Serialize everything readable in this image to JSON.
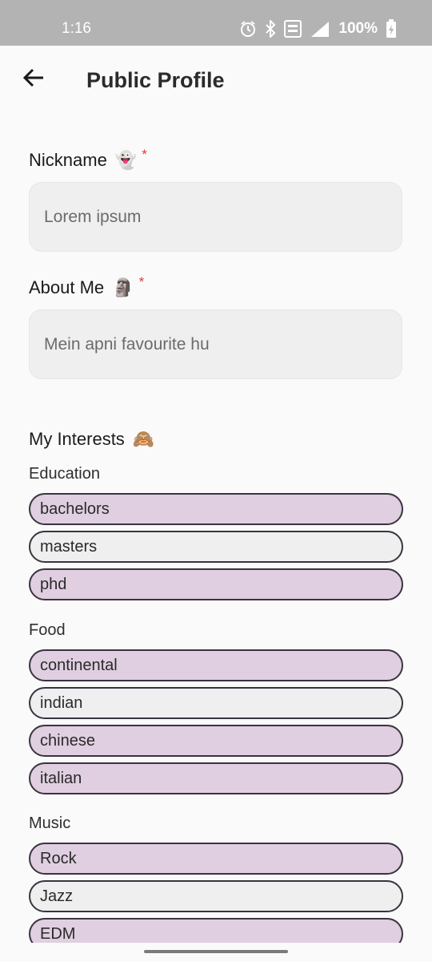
{
  "status_bar": {
    "time": "1:16",
    "battery": "100%",
    "icons": [
      "alarm-icon",
      "bluetooth-icon",
      "volte-icon",
      "signal-4g-icon",
      "battery-icon"
    ]
  },
  "header": {
    "title": "Public Profile",
    "back_icon": "arrow-back-icon"
  },
  "form": {
    "nickname": {
      "label": "Nickname",
      "emoji": "👻",
      "required_mark": "*",
      "value": "Lorem ipsum"
    },
    "about_me": {
      "label": "About Me",
      "emoji": "🗿",
      "required_mark": "*",
      "value": "Mein apni favourite hu"
    }
  },
  "interests": {
    "title": "My Interests",
    "emoji": "🙈",
    "groups": [
      {
        "name": "Education",
        "chips": [
          {
            "label": "bachelors",
            "selected": true
          },
          {
            "label": "masters",
            "selected": false
          },
          {
            "label": "phd",
            "selected": true
          }
        ]
      },
      {
        "name": "Food",
        "chips": [
          {
            "label": "continental",
            "selected": true
          },
          {
            "label": "indian",
            "selected": false
          },
          {
            "label": "chinese",
            "selected": true
          },
          {
            "label": "italian",
            "selected": true
          }
        ]
      },
      {
        "name": "Music",
        "chips": [
          {
            "label": "Rock",
            "selected": true
          },
          {
            "label": "Jazz",
            "selected": false
          },
          {
            "label": "EDM",
            "selected": true
          }
        ]
      }
    ]
  },
  "colors": {
    "chip_selected": "#e0cfe0",
    "chip_unselected": "#efefef",
    "chip_border": "#3a3340",
    "required": "#e53935",
    "status_bar": "#b3b3b3"
  }
}
